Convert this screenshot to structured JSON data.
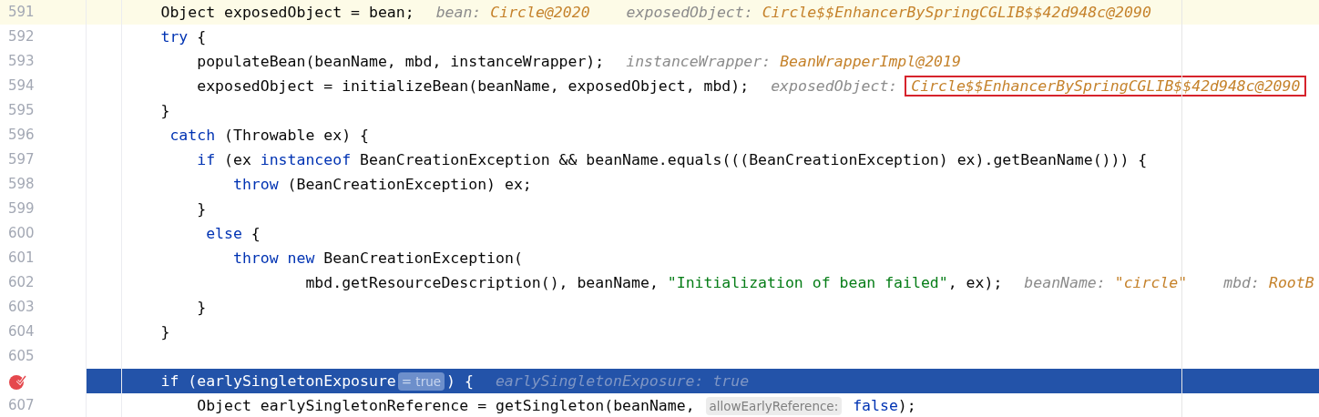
{
  "lines": [
    {
      "number": "591",
      "breakpoint": false,
      "current_line": true,
      "execution_point": false,
      "tokens": [
        {
          "kind": "code",
          "text": "        Object exposedObject = bean;"
        }
      ],
      "hints": [
        {
          "label": "bean:",
          "value": "Circle@2020",
          "boxed": false
        },
        {
          "label": "exposedObject:",
          "value": "Circle$$EnhancerBySpringCGLIB$$42d948c@2090",
          "boxed": false
        }
      ]
    },
    {
      "number": "592",
      "breakpoint": false,
      "current_line": false,
      "execution_point": false,
      "tokens": [
        {
          "kind": "keyword",
          "text": "        try"
        },
        {
          "kind": "code",
          "text": " {"
        }
      ]
    },
    {
      "number": "593",
      "breakpoint": false,
      "current_line": false,
      "execution_point": false,
      "tokens": [
        {
          "kind": "code",
          "text": "            populateBean(beanName, mbd, instanceWrapper);"
        }
      ],
      "hints": [
        {
          "label": "instanceWrapper:",
          "value": "BeanWrapperImpl@2019",
          "boxed": false
        }
      ]
    },
    {
      "number": "594",
      "breakpoint": false,
      "current_line": false,
      "execution_point": false,
      "tokens": [
        {
          "kind": "code",
          "text": "            exposedObject = initializeBean(beanName, exposedObject, mbd);"
        }
      ],
      "hints": [
        {
          "label": "exposedObject:",
          "value": "Circle$$EnhancerBySpringCGLIB$$42d948c@2090",
          "boxed": true
        }
      ]
    },
    {
      "number": "595",
      "breakpoint": false,
      "current_line": false,
      "execution_point": false,
      "tokens": [
        {
          "kind": "code",
          "text": "        }"
        }
      ]
    },
    {
      "number": "596",
      "breakpoint": false,
      "current_line": false,
      "execution_point": false,
      "tokens": [
        {
          "kind": "keyword",
          "text": "         catch"
        },
        {
          "kind": "code",
          "text": " (Throwable ex) {"
        }
      ]
    },
    {
      "number": "597",
      "breakpoint": false,
      "current_line": false,
      "execution_point": false,
      "tokens": [
        {
          "kind": "keyword",
          "text": "            if"
        },
        {
          "kind": "code",
          "text": " (ex "
        },
        {
          "kind": "keyword",
          "text": "instanceof"
        },
        {
          "kind": "code",
          "text": " BeanCreationException && beanName.equals(((BeanCreationException) ex).getBeanName())) {"
        }
      ]
    },
    {
      "number": "598",
      "breakpoint": false,
      "current_line": false,
      "execution_point": false,
      "tokens": [
        {
          "kind": "keyword",
          "text": "                throw"
        },
        {
          "kind": "code",
          "text": " (BeanCreationException) ex;"
        }
      ]
    },
    {
      "number": "599",
      "breakpoint": false,
      "current_line": false,
      "execution_point": false,
      "tokens": [
        {
          "kind": "code",
          "text": "            }"
        }
      ]
    },
    {
      "number": "600",
      "breakpoint": false,
      "current_line": false,
      "execution_point": false,
      "tokens": [
        {
          "kind": "keyword",
          "text": "             else"
        },
        {
          "kind": "code",
          "text": " {"
        }
      ]
    },
    {
      "number": "601",
      "breakpoint": false,
      "current_line": false,
      "execution_point": false,
      "tokens": [
        {
          "kind": "keyword",
          "text": "                throw new"
        },
        {
          "kind": "code",
          "text": " BeanCreationException("
        }
      ]
    },
    {
      "number": "602",
      "breakpoint": false,
      "current_line": false,
      "execution_point": false,
      "tokens": [
        {
          "kind": "code",
          "text": "                        mbd.getResourceDescription(), beanName, "
        },
        {
          "kind": "string",
          "text": "\"Initialization of bean failed\""
        },
        {
          "kind": "code",
          "text": ", ex);"
        }
      ],
      "hints": [
        {
          "label": "beanName:",
          "value": "\"circle\"",
          "boxed": false
        },
        {
          "label": "mbd:",
          "value": "RootB",
          "boxed": false
        }
      ]
    },
    {
      "number": "603",
      "breakpoint": false,
      "current_line": false,
      "execution_point": false,
      "tokens": [
        {
          "kind": "code",
          "text": "            }"
        }
      ]
    },
    {
      "number": "604",
      "breakpoint": false,
      "current_line": false,
      "execution_point": false,
      "tokens": [
        {
          "kind": "code",
          "text": "        }"
        }
      ]
    },
    {
      "number": "605",
      "breakpoint": false,
      "current_line": false,
      "execution_point": false
    },
    {
      "breakpoint": true,
      "current_line": false,
      "execution_point": true,
      "tokens": [
        {
          "kind": "code",
          "text": "        if (earlySingletonExposure"
        },
        {
          "kind": "inlay",
          "text": "= true"
        },
        {
          "kind": "code",
          "text": ") {"
        }
      ],
      "hints": [
        {
          "label": "earlySingletonExposure:",
          "value": "true",
          "boxed": false
        }
      ]
    },
    {
      "number": "607",
      "breakpoint": false,
      "current_line": false,
      "execution_point": false,
      "tokens": [
        {
          "kind": "code",
          "text": "            Object earlySingletonReference = getSingleton(beanName, "
        },
        {
          "kind": "inlay",
          "text": "allowEarlyReference:"
        },
        {
          "kind": "keyword",
          "text": " false"
        },
        {
          "kind": "code",
          "text": ");"
        }
      ]
    }
  ]
}
